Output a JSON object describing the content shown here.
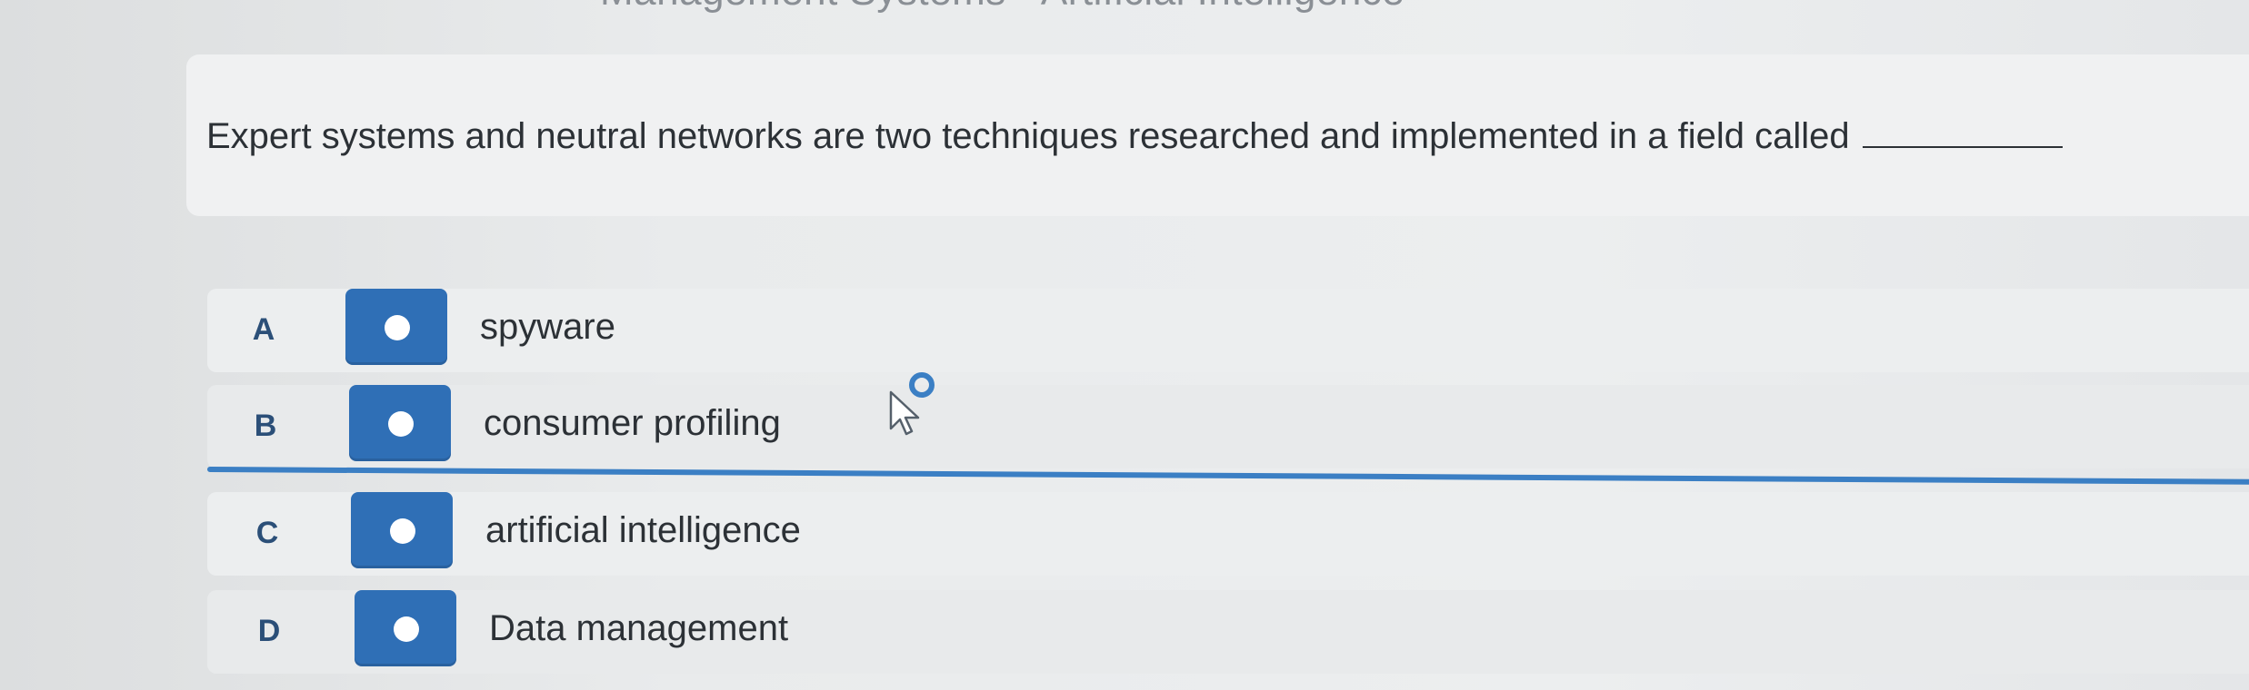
{
  "header": {
    "partial_title": "Management Systems - Artificial Intelligence"
  },
  "question": {
    "text": "Expert systems and neutral networks are two techniques researched and implemented in a field called"
  },
  "options": [
    {
      "letter": "A",
      "label": "spyware"
    },
    {
      "letter": "B",
      "label": "consumer profiling"
    },
    {
      "letter": "C",
      "label": "artificial intelligence"
    },
    {
      "letter": "D",
      "label": "Data management"
    }
  ],
  "colors": {
    "accent": "#2f6fb6",
    "selected_underline": "#3b7fc4",
    "text": "#2c3136",
    "letter": "#2b4f78"
  },
  "icons": {
    "cursor": "pointer-cursor-icon",
    "radio": "radio-dot-icon"
  }
}
